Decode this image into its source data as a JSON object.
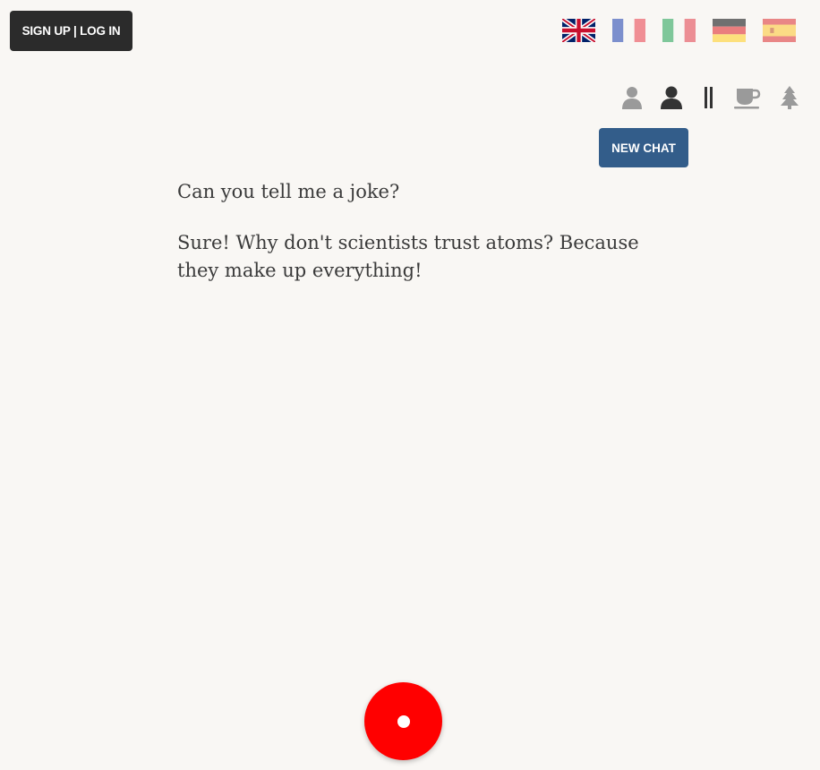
{
  "header": {
    "auth_label": "SIGN UP | LOG IN"
  },
  "languages": [
    {
      "name": "English",
      "icon": "flag-uk-icon"
    },
    {
      "name": "French",
      "icon": "flag-france-icon"
    },
    {
      "name": "Italian",
      "icon": "flag-italy-icon"
    },
    {
      "name": "German",
      "icon": "flag-germany-icon"
    },
    {
      "name": "Spanish",
      "icon": "flag-spain-icon"
    }
  ],
  "modes": [
    {
      "icon": "person-icon",
      "state": "inactive"
    },
    {
      "icon": "person-icon",
      "state": "active"
    },
    {
      "icon": "pause-icon",
      "state": "active"
    },
    {
      "icon": "coffee-icon",
      "state": "inactive"
    },
    {
      "icon": "tree-icon",
      "state": "inactive"
    }
  ],
  "actions": {
    "new_chat_label": "NEW CHAT"
  },
  "chat": {
    "messages": [
      {
        "role": "user",
        "text": "Can you tell me a joke?"
      },
      {
        "role": "assistant",
        "text": "Sure! Why don't scientists trust atoms? Because they make up everything!"
      }
    ]
  },
  "colors": {
    "background": "#f9f7f4",
    "auth_button": "#2b2b2b",
    "new_chat_button": "#335d8a",
    "record_button": "#ff0000",
    "icon_active": "#333333",
    "icon_inactive": "#9a9a9a"
  }
}
